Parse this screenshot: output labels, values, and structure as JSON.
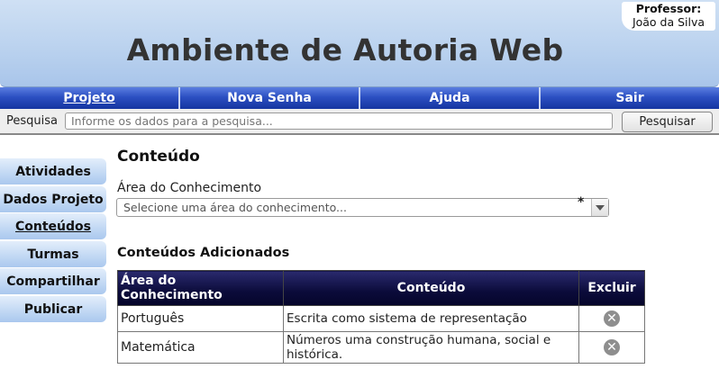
{
  "header": {
    "title": "Ambiente de Autoria Web",
    "professor_label": "Professor:",
    "professor_name": "João da Silva"
  },
  "nav": {
    "items": [
      {
        "label": "Projeto",
        "active": true
      },
      {
        "label": "Nova Senha"
      },
      {
        "label": "Ajuda"
      },
      {
        "label": "Sair"
      }
    ]
  },
  "search": {
    "label": "Pesquisa",
    "placeholder": "Informe os dados para a pesquisa...",
    "button": "Pesquisar"
  },
  "sidebar": {
    "items": [
      {
        "label": "Atividades"
      },
      {
        "label": "Dados Projeto"
      },
      {
        "label": "Conteúdos",
        "active": true
      },
      {
        "label": "Turmas"
      },
      {
        "label": "Compartilhar"
      },
      {
        "label": "Publicar"
      }
    ]
  },
  "main": {
    "title": "Conteúdo",
    "field_label": "Área do Conhecimento",
    "select_value": "Selecione uma área do conhecimento...",
    "required_mark": "*",
    "section_title": "Conteúdos Adicionados",
    "table": {
      "headers": [
        "Área do Conhecimento",
        "Conteúdo",
        "Excluir"
      ],
      "rows": [
        {
          "area": "Português",
          "content": "Escrita como sistema de representação"
        },
        {
          "area": "Matemática",
          "content": "Números uma construção humana, social e histórica."
        }
      ]
    }
  },
  "icons": {
    "delete": "delete-icon",
    "dropdown": "chevron-down-icon"
  },
  "colors": {
    "nav": "#2c50c2",
    "table_header": "#0b0b3a",
    "header_bg": "#b9d1ee"
  }
}
